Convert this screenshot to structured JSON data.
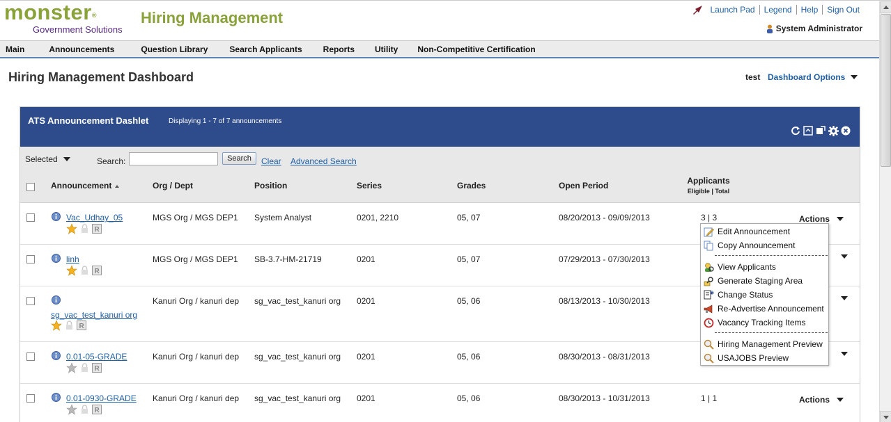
{
  "header": {
    "logo_main": "monster",
    "logo_mark": "®",
    "logo_sub": "Government Solutions",
    "app_title": "Hiring Management",
    "links": [
      "Launch Pad",
      "Legend",
      "Help",
      "Sign Out"
    ],
    "user": "System Administrator"
  },
  "nav": [
    "Main",
    "Announcements",
    "Question Library",
    "Search Applicants",
    "Reports",
    "Utility",
    "Non-Competitive Certification"
  ],
  "dashboard": {
    "title": "Hiring Management Dashboard",
    "user": "test",
    "options": "Dashboard Options"
  },
  "dashlet": {
    "title": "ATS Announcement Dashlet",
    "count": "Displaying 1 - 7 of 7 announcements",
    "selected": "Selected",
    "search_label": "Search:",
    "search_value": "",
    "search_button": "Search",
    "clear": "Clear",
    "advanced": "Advanced Search",
    "columns": {
      "announcement": "Announcement",
      "org": "Org / Dept",
      "position": "Position",
      "series": "Series",
      "grades": "Grades",
      "open": "Open Period",
      "applicants": "Applicants",
      "applicants_sub": "Eligible | Total"
    },
    "actions_label": "Actions",
    "rows": [
      {
        "ann": "Vac_Udhay_05",
        "org": "MGS Org / MGS DEP1",
        "position": "System Analyst",
        "series": "0201, 2210",
        "grades": "05, 07",
        "open": "08/20/2013 - 09/09/2013",
        "applicants": "3 | 3",
        "star": "gold"
      },
      {
        "ann": "linh",
        "org": "MGS Org / MGS DEP1",
        "position": "SB-3.7-HM-21719",
        "series": "0201",
        "grades": "05, 07",
        "open": "07/29/2013 - 07/30/2013",
        "applicants": "",
        "star": "gold"
      },
      {
        "ann": "sg_vac_test_kanuri org",
        "org": "Kanuri Org / kanuri dep",
        "position": "sg_vac_test_kanuri org",
        "series": "0201",
        "grades": "05, 06",
        "open": "08/13/2013 - 10/30/2013",
        "applicants": "",
        "star": "gold"
      },
      {
        "ann": "0.01-05-GRADE",
        "org": "Kanuri Org / kanuri dep",
        "position": "sg_vac_test_kanuri org",
        "series": "0201",
        "grades": "05, 06",
        "open": "08/30/2013 - 08/31/2013",
        "applicants": "",
        "star": "gray"
      },
      {
        "ann": "0.01-0930-GRADE",
        "org": "Kanuri Org / kanuri dep",
        "position": "sg_vac_test_kanuri org",
        "series": "0201",
        "grades": "05, 06",
        "open": "08/30/2013 - 10/31/2013",
        "applicants": "1 | 1",
        "star": "gray"
      }
    ]
  },
  "menu": {
    "items": [
      "Edit Announcement",
      "Copy Announcement",
      "View Applicants",
      "Generate Staging Area",
      "Change Status",
      "Re-Advertise Announcement",
      "Vacancy Tracking Items",
      "Hiring Management Preview",
      "USAJOBS Preview"
    ]
  },
  "colors": {
    "brand_green": "#8aa23a",
    "brand_purple": "#5b2a86",
    "dashlet_header": "#2e4b8c",
    "link": "#1f5fa5"
  }
}
